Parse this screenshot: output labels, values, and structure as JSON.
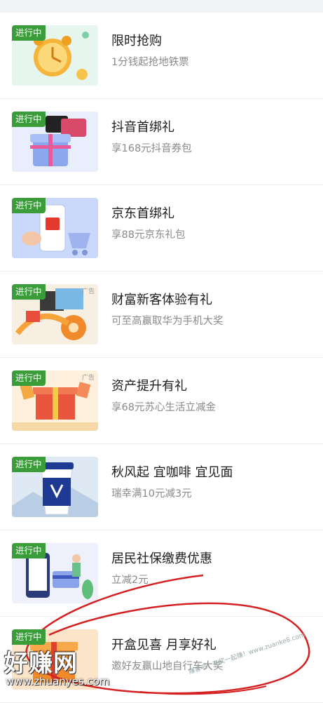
{
  "status_badge": "进行中",
  "ad_label": "广告",
  "items": [
    {
      "title": "限时抢购",
      "subtitle": "1分钱起抢地铁票",
      "image": "alarm-clock-promo-image",
      "ad": false
    },
    {
      "title": "抖音首绑礼",
      "subtitle": "享168元抖音券包",
      "image": "douyin-gift-box-image",
      "ad": false
    },
    {
      "title": "京东首绑礼",
      "subtitle": "享88元京东礼包",
      "image": "jd-phone-cart-image",
      "ad": false
    },
    {
      "title": "财富新客体验有礼",
      "subtitle": "可至高赢取华为手机大奖",
      "image": "wealth-gift-image",
      "ad": true
    },
    {
      "title": "资产提升有礼",
      "subtitle": "享68元苏心生活立减金",
      "image": "asset-gift-image",
      "ad": true
    },
    {
      "title": "秋风起 宜咖啡 宜见面",
      "subtitle": "瑞幸满10元减3元",
      "image": "luckin-coffee-cup-image",
      "ad": false
    },
    {
      "title": "居民社保缴费优惠",
      "subtitle": "立减2元",
      "image": "social-insurance-image",
      "ad": false
    },
    {
      "title": "开盒见喜 月享好礼",
      "subtitle": "邀好友赢山地自行车大奖",
      "image": "gift-box-promo-image",
      "ad": false
    }
  ],
  "watermark": {
    "brand": "好赚网",
    "url": "www.zhuanyes.com",
    "corner_text": "赚客吧，有奖一起赚！www.zuanke8.com"
  },
  "colors": {
    "badge": "#3a9d3a",
    "title": "#1d1d1d",
    "subtitle": "#8a8a8a",
    "circle": "#d42020"
  }
}
